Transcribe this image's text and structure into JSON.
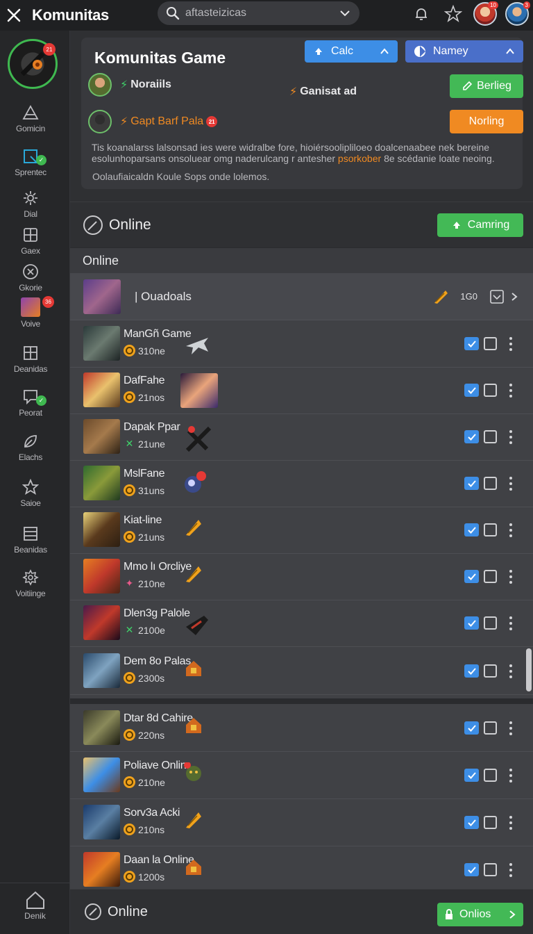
{
  "topbar": {
    "title": "Komunitas",
    "search_placeholder": "aftasteizicas"
  },
  "sidebar": {
    "items": [
      {
        "label": "Gomicin",
        "icon": "triangle-icon"
      },
      {
        "label": "Sprentec",
        "icon": "square-icon"
      },
      {
        "label": "Dial",
        "icon": "gear-icon"
      },
      {
        "label": "Gaex",
        "icon": "grid-icon"
      },
      {
        "label": "Gkorie",
        "icon": "compass-icon"
      },
      {
        "label": "Voive",
        "icon": "avatar-icon"
      },
      {
        "label": "Deanidas",
        "icon": "box-icon"
      },
      {
        "label": "Peorat",
        "icon": "chat-icon"
      },
      {
        "label": "Elachs",
        "icon": "leaf-icon"
      },
      {
        "label": "Saioe",
        "icon": "star-icon"
      },
      {
        "label": "Beanidas",
        "icon": "list-icon"
      },
      {
        "label": "Voitiinge",
        "icon": "cog-icon"
      }
    ],
    "bottom_label": "Denik"
  },
  "header": {
    "title": "Komunitas Game",
    "btn_calc": "Calc",
    "btn_namey": "Namey",
    "player1": "Noraiils",
    "tag": "Ganisat ad",
    "btn_berlieg": "Berlieg",
    "player2": "Gapt Barf Pala",
    "btn_norling": "Norling",
    "desc_line1": "Tis koanalarss lalsonsad ies were widralbe fore, hioiérsoolipliloeo doalcenaabee nek bereine",
    "desc_line2a": "esolunhoparsans onsoluear omg naderulcang r antesher",
    "desc_highlight": "psorkober",
    "desc_line2b": "8e scédanie loate neoing.",
    "sub": "Oolaufiaicaldn Koule Sops onde lolemos."
  },
  "online_section": {
    "title": "Online",
    "btn_camping": "Camring",
    "subheader": "Online"
  },
  "pinned": {
    "title": "| Ouadoals",
    "count": "1G0"
  },
  "rows": [
    {
      "name": "ManGñ Game",
      "stat": "310ne"
    },
    {
      "name": "DafFahe",
      "stat": "21nos"
    },
    {
      "name": "Dapak Ppar",
      "stat": "21une"
    },
    {
      "name": "MslFane",
      "stat": "31uns"
    },
    {
      "name": "Kiat-line",
      "stat": "21uns"
    },
    {
      "name": "Mmo lı Orcliye",
      "stat": "210ne"
    },
    {
      "name": "Dlen3g Palole",
      "stat": "2100e"
    },
    {
      "name": "Dem 8o Palas",
      "stat": "2300s"
    },
    {
      "name": "Dtar 8d Cahire",
      "stat": "220ns"
    },
    {
      "name": "Poliave Onlin",
      "stat": "210ne"
    },
    {
      "name": "Sorv3a Acki",
      "stat": "210ns"
    },
    {
      "name": "Daan la Online",
      "stat": "1200s"
    }
  ],
  "bottom": {
    "title": "Online",
    "btn": "Onlios"
  },
  "colors": {
    "accent_blue": "#3d8ee6",
    "accent_green": "#43b956",
    "accent_orange": "#f08a22",
    "badge_red": "#e53935"
  }
}
